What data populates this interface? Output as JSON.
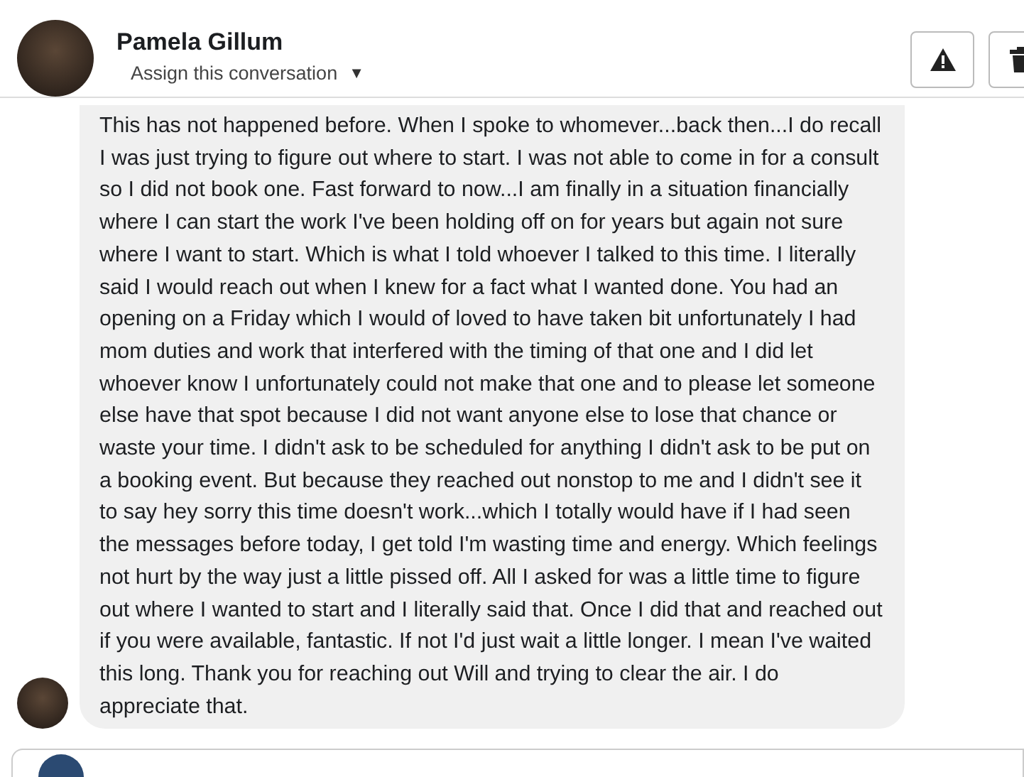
{
  "header": {
    "name": "Pamela Gillum",
    "assign": {
      "label": "Assign this conversation",
      "caret": "▼"
    }
  },
  "message": {
    "text": "This has not happened before. When I spoke to whomever...back then...I do recall I was just trying to figure out where to start. I was not able to come in for a consult so I did not book one. Fast forward to now...I am finally in a situation financially where I can start the work I've been holding off on for years but again not sure where I want to start. Which is what I told whoever I talked to this time. I literally said I would reach out when I knew for a fact what I wanted done. You had an opening on a Friday which I would of loved to have taken bit unfortunately I had mom duties and work that interfered with the timing of that one and I did let whoever know I unfortunately could not make that one and to please let someone else have that spot because I did not want anyone else to lose that chance or waste your time. I didn't ask to be scheduled for anything I didn't ask to be put on a booking event. But because they reached out nonstop to me and I didn't see it to say hey sorry this time doesn't work...which I totally would have if I had seen the messages before today,  I get told I'm wasting time and energy. Which feelings not hurt by the way just a little pissed off.  All I asked for was a little time to figure out where I wanted to start and I literally said that. Once I did that and reached out if you were available, fantastic. If not I'd just wait a little longer. I mean I've waited this long. Thank you for reaching out Will and trying to clear the air. I do appreciate that."
  }
}
